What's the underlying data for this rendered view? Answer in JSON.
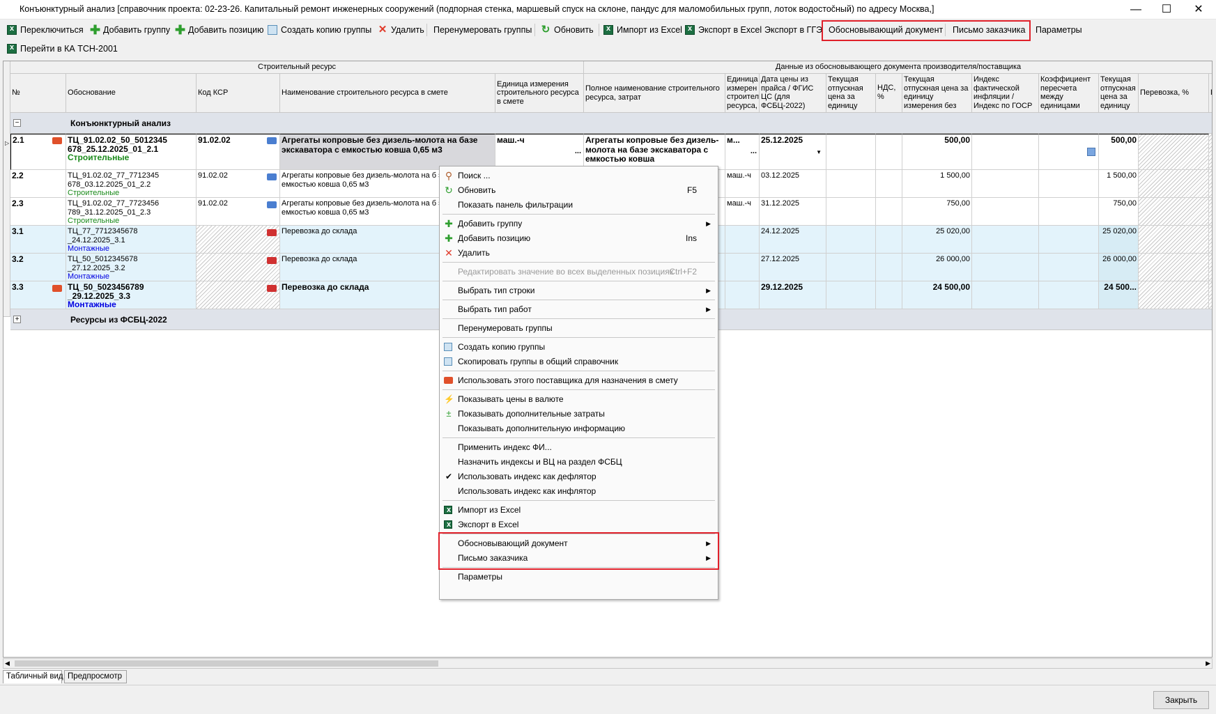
{
  "window": {
    "title": "Конъюнктурный анализ [справочник проекта: 02-23-26. Капитальный ремонт инженерных сооружений (подпорная стенка, маршевый спуск на склоне, пандус для маломобильных групп, лоток водостоčный) по адресу Москва,]",
    "minimize": "—",
    "maximize": "☐",
    "close": "✕"
  },
  "toolbar": {
    "switch": "Переключиться",
    "add_group": "Добавить группу",
    "add_position": "Добавить позицию",
    "copy_group": "Создать копию группы",
    "delete": "Удалить",
    "renumber": "Перенумеровать группы",
    "refresh": "Обновить",
    "import_excel": "Импорт из Excel",
    "export_excel": "Экспорт в Excel",
    "export_gge": "Экспорт в ГГЭ",
    "justifying_doc": "Обосновывающий документ",
    "customer_letter": "Письмо заказчика",
    "params": "Параметры",
    "goto_ka": "Перейти в КА ТСН-2001"
  },
  "grid": {
    "band_left": "Строительный ресурс",
    "band_right": "Данные из обосновывающего документа производителя/поставщика",
    "columns": {
      "num": "№",
      "basis": "Обоснование",
      "ksr": "Код КСР",
      "name": "Наименование строительного ресурса в смете",
      "unit": "Единица измерения строительного ресурса в смете",
      "full_name": "Полное наименование строительного ресурса, затрат",
      "unit2": "Единица измерен строител ресурса,",
      "price_date": "Дата цены из прайса / ФГИС ЦС (для ФСБЦ-2022)",
      "cur_price": "Текущая отпускная цена за единицу",
      "vat": "НДС, %",
      "cur_price_unit": "Текущая отпускная цена за единицу измерения без",
      "infl_index": "Индекс фактической инфляции / Индекс по ГОСР",
      "coef": "Коэффициент пересчета между единицами",
      "cur_price2": "Текущая отпускная цена за единицу",
      "transport": "Перевозка, %",
      "p": "П"
    },
    "group1": {
      "toggle": "−",
      "label": "Конъюнктурный анализ"
    },
    "group2": {
      "toggle": "+",
      "label": "Ресурсы из ФСБЦ-2022"
    },
    "rows": [
      {
        "num": "2.1",
        "basis": "ТЦ_91.02.02_50_5012345 678_25.12.2025_01_2.1",
        "type": "Строительные",
        "ksr": "91.02.02",
        "name": "Агрегаты копровые без дизель-молота на базе экскаватора с емкостью ковша 0,65 м3",
        "unit": "маш.-ч",
        "full_name": "Агрегаты копровые без дизель-молота на базе экскаватора с емкостью ковша",
        "unit2": "м...",
        "date": "25.12.2025",
        "price_unit": "500,00",
        "price2": "500,00"
      },
      {
        "num": "2.2",
        "basis": "ТЦ_91.02.02_77_7712345 678_03.12.2025_01_2.2",
        "type": "Строительные",
        "ksr": "91.02.02",
        "name": "Агрегаты копровые без дизель-молота на б экскаватора с емкостью ковша 0,65 м3",
        "unit2": "маш.-ч",
        "date": "03.12.2025",
        "price_unit": "1 500,00",
        "price2": "1 500,00"
      },
      {
        "num": "2.3",
        "basis": "ТЦ_91.02.02_77_7723456 789_31.12.2025_01_2.3",
        "type": "Строительные",
        "ksr": "91.02.02",
        "name": "Агрегаты копровые без дизель-молота на б экскаватора с емкостью ковша 0,65 м3",
        "unit2": "маш.-ч",
        "date": "31.12.2025",
        "price_unit": "750,00",
        "price2": "750,00"
      },
      {
        "num": "3.1",
        "basis": "ТЦ_77_7712345678 _24.12.2025_3.1",
        "type": "Монтажные",
        "name": "Перевозка до склада",
        "date": "24.12.2025",
        "price_unit": "25 020,00",
        "price2": "25 020,00"
      },
      {
        "num": "3.2",
        "basis": "ТЦ_50_5012345678 _27.12.2025_3.2",
        "type": "Монтажные",
        "name": "Перевозка до склада",
        "date": "27.12.2025",
        "price_unit": "26 000,00",
        "price2": "26 000,00"
      },
      {
        "num": "3.3",
        "basis": "ТЦ_50_5023456789 _29.12.2025_3.3",
        "type": "Монтажные",
        "name": "Перевозка до склада",
        "date": "29.12.2025",
        "price_unit": "24 500,00",
        "price2": "24 500..."
      }
    ]
  },
  "context_menu": {
    "search": "Поиск ...",
    "refresh": "Обновить",
    "refresh_sc": "F5",
    "filter_panel": "Показать панель фильтрации",
    "add_group": "Добавить группу",
    "add_position": "Добавить позицию",
    "add_position_sc": "Ins",
    "delete": "Удалить",
    "edit_all": "Редактировать значение во всех выделенных позициях",
    "edit_all_sc": "Ctrl+F2",
    "row_type": "Выбрать тип строки",
    "work_type": "Выбрать тип работ",
    "renumber": "Перенумеровать группы",
    "copy_group": "Создать копию группы",
    "copy_to_common": "Скопировать группы в общий справочник",
    "use_supplier": "Использовать этого поставщика для назначения в смету",
    "show_currency": "Показывать цены в валюте",
    "show_extra_costs": "Показывать дополнительные затраты",
    "show_extra_info": "Показывать дополнительную информацию",
    "apply_index": "Применить индекс ФИ...",
    "assign_indexes": "Назначить индексы и ВЦ на раздел ФСБЦ",
    "index_deflator": "Использовать индекс как дефлятор",
    "index_inflator": "Использовать индекс как инфлятор",
    "import_excel": "Импорт из Excel",
    "export_excel": "Экспорт в Excel",
    "justifying_doc": "Обосновывающий документ",
    "customer_letter": "Письмо заказчика",
    "params": "Параметры",
    "check": "✔",
    "arrow": "▶"
  },
  "tabs": {
    "table_view": "Табличный вид",
    "preview": "Предпросмотр"
  },
  "footer": {
    "close": "Закрыть"
  },
  "colors": {
    "highlight": "#e0202a",
    "group_bg": "#dfe3ea",
    "row_blue": "#e3f3fb",
    "green_text": "#1a8a1a",
    "blue_text": "#0000e0"
  }
}
